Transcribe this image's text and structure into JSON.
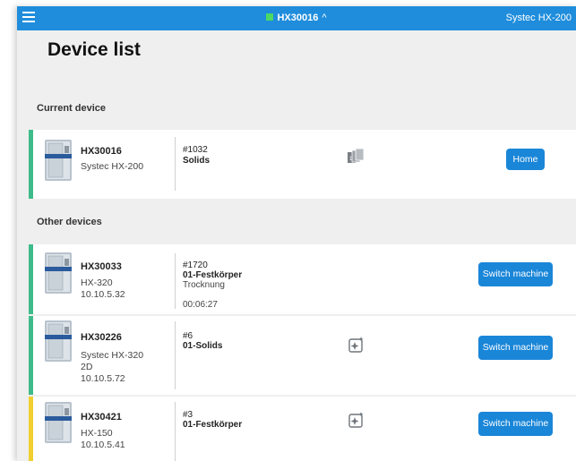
{
  "topbar": {
    "center_label": "HX30016",
    "center_status_color": "#4cd964",
    "right_label": "Systec HX-200"
  },
  "page": {
    "title": "Device list"
  },
  "current_section": {
    "title": "Current device"
  },
  "other_section": {
    "title": "Other devices"
  },
  "current_device": {
    "name": "HX30016",
    "info": [
      "Systec HX-200"
    ],
    "job_number": "#1032",
    "job_name": "Solids",
    "job_step": "",
    "time": "",
    "job_icon": "book-pages-icon",
    "button": "Home",
    "stripe_color": "#3dbb8a"
  },
  "other_devices": [
    {
      "name": "HX30033",
      "info": [
        "HX-320",
        "10.10.5.32"
      ],
      "job_number": "#1720",
      "job_name": "01-Festkörper",
      "job_step": "Trocknung",
      "time": "00:06:27",
      "job_icon": "",
      "button": "Switch machine",
      "stripe_color": "#3dbb8a"
    },
    {
      "name": "HX30226",
      "info": [
        "Systec HX-320",
        "2D",
        "10.10.5.72"
      ],
      "job_number": "#6",
      "job_name": "01-Solids",
      "job_step": "",
      "time": "",
      "job_icon": "sparkle-clean-icon",
      "button": "Switch machine",
      "stripe_color": "#3dbb8a"
    },
    {
      "name": "HX30421",
      "info": [
        "HX-150",
        "10.10.5.41"
      ],
      "job_number": "#3",
      "job_name": "01-Festkörper",
      "job_step": "",
      "time": "",
      "job_icon": "sparkle-clean-icon",
      "button": "Switch machine",
      "stripe_color": "#f0cf2e"
    }
  ]
}
